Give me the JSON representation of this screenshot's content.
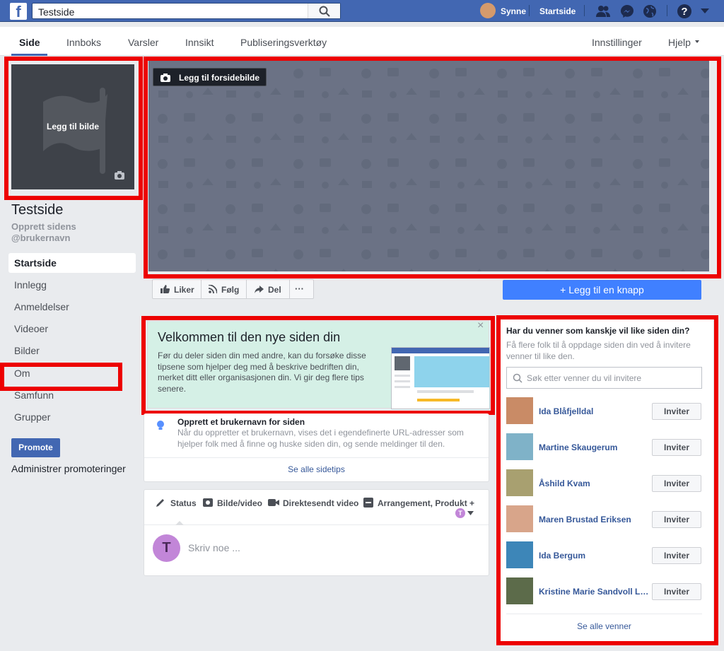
{
  "topbar": {
    "logo": "f",
    "search_value": "Testside",
    "user_name": "Synne",
    "home_label": "Startside"
  },
  "subnav": {
    "tabs": [
      "Side",
      "Innboks",
      "Varsler",
      "Innsikt",
      "Publiseringsverktøy"
    ],
    "settings": "Innstillinger",
    "help": "Hjelp"
  },
  "profile": {
    "add_photo": "Legg til bilde",
    "page_name": "Testside",
    "username_line1": "Opprett sidens",
    "username_line2": "@brukernavn"
  },
  "cover": {
    "add_cover": "Legg til forsidebilde"
  },
  "sidebar": {
    "items": [
      "Startside",
      "Innlegg",
      "Anmeldelser",
      "Videoer",
      "Bilder",
      "Om",
      "Samfunn",
      "Grupper"
    ],
    "promote": "Promote",
    "manage_promotions": "Administrer promoteringer"
  },
  "actions": {
    "like": "Liker",
    "follow": "Følg",
    "share": "Del",
    "more": "···",
    "add_button": "+ Legg til en knapp"
  },
  "welcome": {
    "title": "Velkommen til den nye siden din",
    "body": "Før du deler siden din med andre, kan du forsøke disse tipsene som hjelper deg med å beskrive bedriften din, merket ditt eller organisasjonen din. Vi gir deg flere tips senere.",
    "close": "×"
  },
  "tip": {
    "title": "Opprett et brukernavn for siden",
    "body": "Når du oppretter et brukernavn, vises det i egendefinerte URL-adresser som hjelper folk med å finne og huske siden din, og sende meldinger til den.",
    "see_all": "Se alle sidetips"
  },
  "composer": {
    "tabs": [
      "Status",
      "Bilde/video",
      "Direktesendt video",
      "Arrangement, Produkt +"
    ],
    "avatar_letter": "T",
    "placeholder": "Skriv noe ..."
  },
  "invite": {
    "title": "Har du venner som kanskje vil like siden din?",
    "subtitle": "Få flere folk til å oppdage siden din ved å invitere venner til like den.",
    "search_placeholder": "Søk etter venner du vil invitere",
    "button_label": "Inviter",
    "friends": [
      {
        "name": "Ida Blåfjelldal",
        "color": "#c98b66"
      },
      {
        "name": "Martine Skaugerum",
        "color": "#7fb2c8"
      },
      {
        "name": "Åshild Kvam",
        "color": "#a8a070"
      },
      {
        "name": "Maren Brustad Eriksen",
        "color": "#d8a58a"
      },
      {
        "name": "Ida Bergum",
        "color": "#3d86b8"
      },
      {
        "name": "Kristine Marie Sandvoll Li...",
        "color": "#5c6b4a"
      }
    ],
    "see_all": "Se alle venner"
  },
  "colors": {
    "brand": "#4267b2",
    "highlight": "#ed0000",
    "welcome_bg": "#d5f0e6",
    "add_button": "#4080ff"
  }
}
